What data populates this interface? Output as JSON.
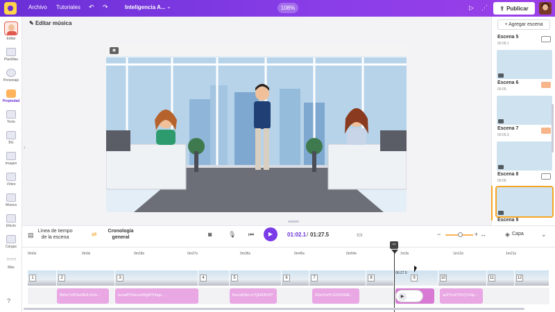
{
  "app": {
    "menu": [
      "Archivo",
      "Tutoriales"
    ],
    "project_title": "Inteligencia A...",
    "zoom": "108%",
    "publish_label": "Publicar"
  },
  "colors": {
    "brand_purple": "#6a2fd6",
    "accent_orange": "#f6a623",
    "audio_pink": "#e9a7e4"
  },
  "sidebar": {
    "items": [
      {
        "label": "Editar",
        "icon": "avatar-icon"
      },
      {
        "label": "Plantillas",
        "icon": "templates-icon"
      },
      {
        "label": "Personaje",
        "icon": "character-icon"
      },
      {
        "label": "Propiedad",
        "icon": "properties-icon",
        "active": true
      },
      {
        "label": "Texto",
        "icon": "text-icon"
      },
      {
        "label": "BG",
        "icon": "background-icon"
      },
      {
        "label": "Imagen",
        "icon": "image-icon"
      },
      {
        "label": "Vídeo",
        "icon": "video-icon"
      },
      {
        "label": "Música",
        "icon": "music-icon"
      },
      {
        "label": "Efecto",
        "icon": "effect-icon"
      },
      {
        "label": "Cargas",
        "icon": "uploads-icon"
      },
      {
        "label": "Más",
        "icon": "more-icon"
      }
    ]
  },
  "editor": {
    "edit_music_label": "Editar música"
  },
  "scenes_panel": {
    "add_label": "+ Agregar escena",
    "scenes": [
      {
        "name": "Escena 5",
        "time": "00:09.1"
      },
      {
        "name": "Escena 6",
        "time": "00:05."
      },
      {
        "name": "Escena 7",
        "time": "00:05.9"
      },
      {
        "name": "Escena 8",
        "time": "00:06."
      },
      {
        "name": "Escena 9",
        "time": ""
      }
    ]
  },
  "timeline": {
    "scene_timeline_label": "Línea de tiempo de la escena",
    "general_label": "Cronología general",
    "current_time": "01:02.1",
    "total_time": "01:27.5",
    "layer_label": "Capa",
    "ruler": [
      "0m0s",
      "0m9s",
      "0m18s",
      "0m27s",
      "0m36s",
      "0m45s",
      "0m54s",
      "1m3s",
      "1m12s",
      "1m21s"
    ],
    "scene_numbers": [
      "1",
      "2",
      "3",
      "4",
      "5",
      "6",
      "7",
      "8",
      "9",
      "10",
      "11",
      "12"
    ],
    "playhead_scene_time": "00:27.5",
    "audio_clips": [
      "Bk9n7vRSsvMULfzXe...",
      "bcoaRTtxkcooWgM7nhgs...",
      "BzrzdtSpLm7QHd3hVf7",
      "A3zVmrPc22HSXkB...",
      "acPVmt7FkYjYs9p..."
    ]
  }
}
